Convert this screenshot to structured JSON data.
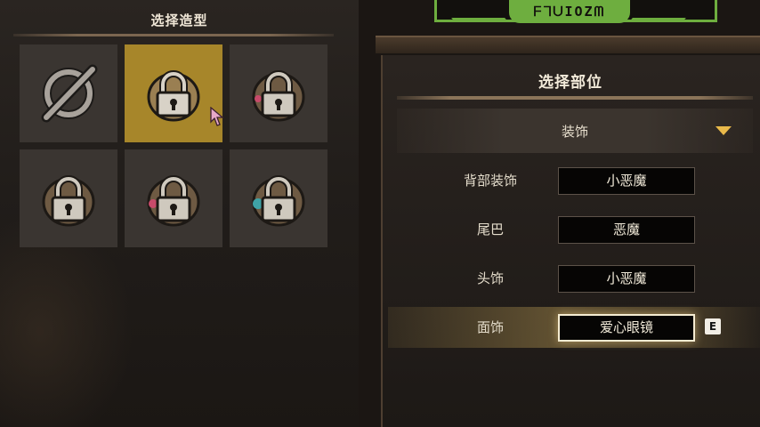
{
  "left_panel": {
    "title": "选择造型",
    "grid": [
      {
        "icon": "none-icon",
        "locked": false,
        "selected": false
      },
      {
        "icon": "lock-icon",
        "locked": true,
        "selected": true
      },
      {
        "icon": "lock-icon",
        "locked": true,
        "selected": false,
        "accent": "#c84a6a"
      },
      {
        "icon": "lock-icon",
        "locked": true,
        "selected": false
      },
      {
        "icon": "lock-icon",
        "locked": true,
        "selected": false,
        "accent": "#c84a6a"
      },
      {
        "icon": "lock-icon",
        "locked": true,
        "selected": false,
        "accent": "#3fa3a6"
      }
    ]
  },
  "emblem": {
    "text": "ᖴᒣᑌIOZᗰ"
  },
  "right_panel": {
    "title": "选择部位",
    "category": {
      "label": "装饰",
      "icon": "dropdown-arrow-icon"
    },
    "parts": [
      {
        "label": "背部装饰",
        "value": "小恶魔"
      },
      {
        "label": "尾巴",
        "value": "恶魔"
      },
      {
        "label": "头饰",
        "value": "小恶魔"
      },
      {
        "label": "面饰",
        "value": "爱心眼镜",
        "highlighted": true,
        "key_hint": "E"
      }
    ]
  },
  "colors": {
    "selected_cell": "#a7862a",
    "accent_green": "#6eae3f",
    "dropdown_arrow": "#e9b94a"
  }
}
